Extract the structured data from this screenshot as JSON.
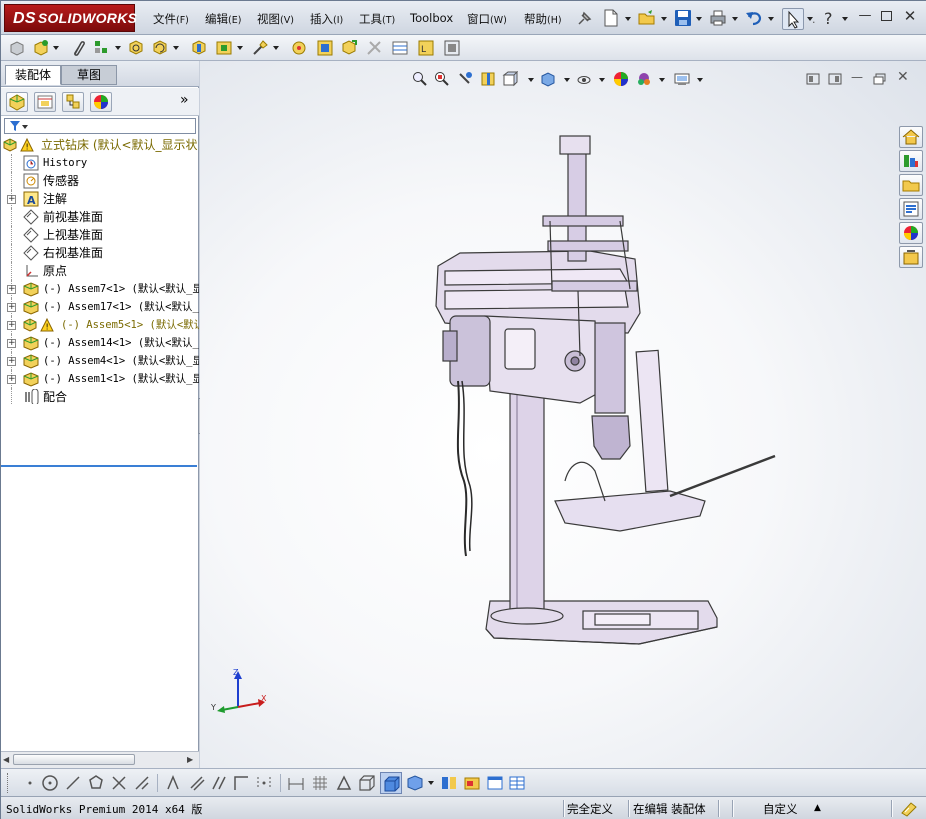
{
  "app": {
    "logo_text": "SOLIDWORKS",
    "logo_prefix": "DS"
  },
  "menu": {
    "items": [
      {
        "label": "文件",
        "accel": "(F)"
      },
      {
        "label": "编辑",
        "accel": "(E)"
      },
      {
        "label": "视图",
        "accel": "(V)"
      },
      {
        "label": "插入",
        "accel": "(I)"
      },
      {
        "label": "工具",
        "accel": "(T)"
      },
      {
        "label": "Toolbox",
        "accel": ""
      },
      {
        "label": "窗口",
        "accel": "(W)"
      },
      {
        "label": "帮助",
        "accel": "(H)"
      }
    ]
  },
  "feature_manager": {
    "tabs": [
      "装配体",
      "草图"
    ],
    "active_tab": "装配体",
    "collapse_symbol": "»",
    "tree": [
      {
        "label": "立式钻床  (默认<默认_显示状",
        "icon": "assembly-warning-icon",
        "expand": false,
        "root": true
      },
      {
        "label": "History",
        "icon": "history-icon",
        "mono": true
      },
      {
        "label": "传感器",
        "icon": "sensor-icon"
      },
      {
        "label": "注解",
        "icon": "annotation-icon",
        "expand": true
      },
      {
        "label": "前视基准面",
        "icon": "plane-icon"
      },
      {
        "label": "上视基准面",
        "icon": "plane-icon"
      },
      {
        "label": "右视基准面",
        "icon": "plane-icon"
      },
      {
        "label": "原点",
        "icon": "origin-icon"
      },
      {
        "label": "(-) Assem7<1> (默认<默认_显",
        "icon": "subassembly-icon",
        "expand": true,
        "mono": true
      },
      {
        "label": "(-) Assem17<1> (默认<默认_",
        "icon": "subassembly-icon",
        "expand": true,
        "mono": true
      },
      {
        "label": "(-) Assem5<1> (默认<默认",
        "icon": "subassembly-warning-icon",
        "expand": true,
        "mono": true,
        "warning": true
      },
      {
        "label": "(-) Assem14<1> (默认<默认_",
        "icon": "subassembly-icon",
        "expand": true,
        "mono": true
      },
      {
        "label": "(-) Assem4<1> (默认<默认_显",
        "icon": "subassembly-icon",
        "expand": true,
        "mono": true
      },
      {
        "label": "(-) Assem1<1> (默认<默认_显",
        "icon": "subassembly-icon",
        "expand": true,
        "mono": true
      },
      {
        "label": "配合",
        "icon": "mates-icon"
      }
    ]
  },
  "triad": {
    "x": "X",
    "y": "Y",
    "z": "Z"
  },
  "status": {
    "product": "SolidWorks Premium 2014 x64 版",
    "definition": "完全定义",
    "mode": "在编辑 装配体",
    "units": "自定义",
    "units_caret": "▲"
  },
  "colors": {
    "logo_red": "#a31515",
    "tree_warning_text": "#7a6a00",
    "selection_blue": "#3a7fd5",
    "viewport_bg": "#f7f8fa"
  }
}
